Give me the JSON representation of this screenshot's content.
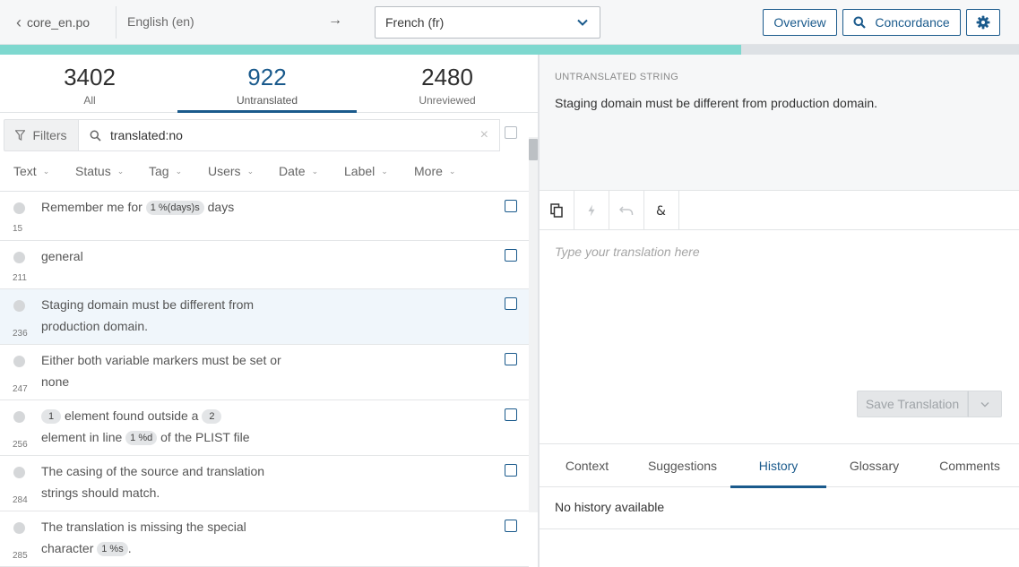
{
  "topbar": {
    "file_name": "core_en.po",
    "source_language": "English (en)",
    "arrow": "→",
    "target_language": "French (fr)",
    "overview_label": "Overview",
    "concordance_label": "Concordance"
  },
  "progress": {
    "percent": 72.7
  },
  "stats": [
    {
      "count": "3402",
      "label": "All"
    },
    {
      "count": "922",
      "label": "Untranslated"
    },
    {
      "count": "2480",
      "label": "Unreviewed"
    }
  ],
  "filters": {
    "button_label": "Filters",
    "search_value": "translated:no",
    "clear": "×"
  },
  "facets": [
    "Text",
    "Status",
    "Tag",
    "Users",
    "Date",
    "Label",
    "More"
  ],
  "strings": [
    {
      "id": "15",
      "parts": [
        "Remember me for ",
        "1 %(days)s",
        " days"
      ]
    },
    {
      "id": "211",
      "text": "general"
    },
    {
      "id": "236",
      "text": "Staging domain must be different from production domain."
    },
    {
      "id": "247",
      "text": "Either both variable markers must be set or none"
    },
    {
      "id": "256",
      "parts": [
        "1",
        " element found outside a ",
        "2",
        " element in line ",
        "1 %d",
        " of the PLIST file"
      ]
    },
    {
      "id": "284",
      "text": "The casing of the source and translation strings should match."
    },
    {
      "id": "285",
      "parts": [
        "The translation is missing the special character ",
        "1 %s",
        "."
      ]
    }
  ],
  "source_panel": {
    "caption": "UNTRANSLATED STRING",
    "text": "Staging domain must be different from production domain."
  },
  "editor": {
    "placeholder": "Type your translation here",
    "save_label": "Save Translation"
  },
  "tabs": [
    "Context",
    "Suggestions",
    "History",
    "Glossary",
    "Comments"
  ],
  "history": {
    "empty_text": "No history available"
  }
}
